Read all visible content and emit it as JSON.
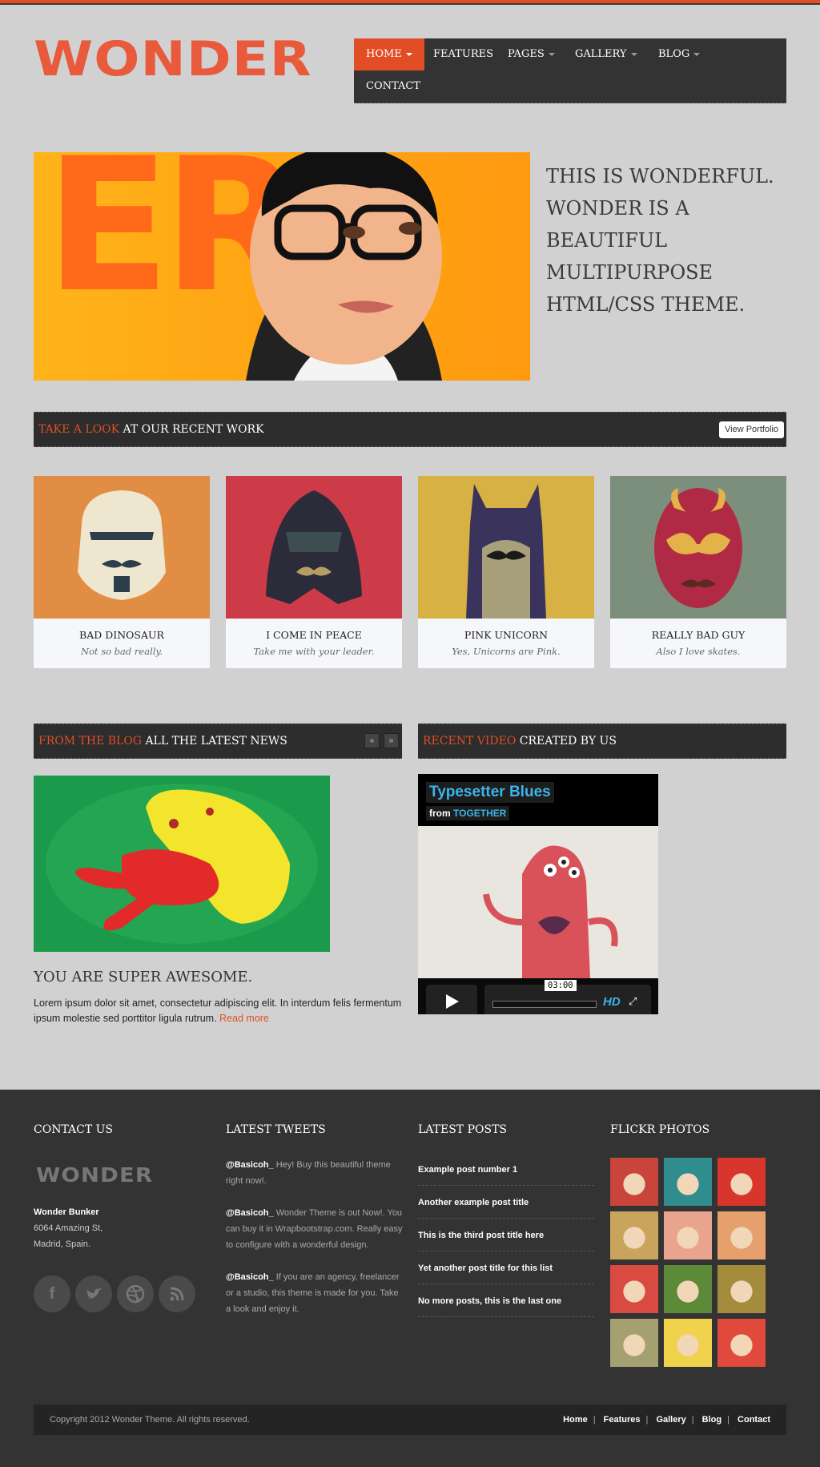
{
  "site": {
    "logo": "WONDER",
    "accent_color": "#e14e26"
  },
  "nav": {
    "items": [
      {
        "label": "HOME",
        "dropdown": true,
        "active": true
      },
      {
        "label": "FEATURES",
        "dropdown": false,
        "active": false
      },
      {
        "label": "PAGES",
        "dropdown": true,
        "active": false
      },
      {
        "label": "GALLERY",
        "dropdown": true,
        "active": false
      },
      {
        "label": "BLOG",
        "dropdown": true,
        "active": false
      },
      {
        "label": "CONTACT",
        "dropdown": false,
        "active": false
      }
    ]
  },
  "hero": {
    "headline": "THIS IS WONDERFUL. WONDER IS A BEAUTIFUL MULTIPURPOSE HTML/CSS THEME.",
    "image_letters": "ER"
  },
  "recent_work": {
    "title_accent": "TAKE A LOOK",
    "title_rest": "AT OUR RECENT WORK",
    "button": "View Portfolio",
    "items": [
      {
        "title": "BAD DINOSAUR",
        "subtitle": "Not so bad really.",
        "bg": "#e18e44"
      },
      {
        "title": "I COME IN PEACE",
        "subtitle": "Take me with your leader.",
        "bg": "#cd3a48"
      },
      {
        "title": "PINK UNICORN",
        "subtitle": "Yes, Unicorns are Pink.",
        "bg": "#d7b143"
      },
      {
        "title": "REALLY BAD GUY",
        "subtitle": "Also I love skates.",
        "bg": "#7c8e7c"
      }
    ]
  },
  "blog": {
    "title_accent": "FROM THE BLOG",
    "title_rest": "ALL THE LATEST NEWS",
    "prev": "«",
    "next": "»",
    "post_title": "YOU ARE SUPER AWESOME.",
    "excerpt": "Lorem ipsum dolor sit amet, consectetur adipiscing elit. In interdum felis fermentum ipsum molestie sed porttitor ligula rutrum.",
    "read_more": "Read more"
  },
  "video": {
    "title_accent": "RECENT VIDEO",
    "title_rest": "CREATED BY US",
    "video_title": "Typesetter Blues",
    "from_label": "from",
    "from_name": "TOGETHER",
    "time": "03:00",
    "hd": "HD"
  },
  "footer": {
    "contact": {
      "heading": "CONTACT US",
      "logo": "WONDER",
      "name": "Wonder Bunker",
      "address1": "6064 Amazing St,",
      "address2": "Madrid, Spain.",
      "social": [
        "facebook-icon",
        "twitter-icon",
        "dribbble-icon",
        "rss-icon"
      ]
    },
    "tweets": {
      "heading": "LATEST TWEETS",
      "items": [
        {
          "user": "@Basicoh_",
          "text": " Hey! Buy this beautiful theme right now!."
        },
        {
          "user": "@Basicoh_",
          "text": " Wonder Theme is out Now!. You can buy it in Wrapbootstrap.com. Really easy to configure with a wonderful design."
        },
        {
          "user": "@Basicoh_",
          "text": " If you are an agency, freelancer or a studio, this theme is made for you. Take a look and enjoy it."
        }
      ]
    },
    "posts": {
      "heading": "LATEST POSTS",
      "items": [
        "Example post number 1",
        "Another example post title",
        "This is the third post title here",
        "Yet another post title for this list",
        "No more posts, this is the last one"
      ]
    },
    "flickr": {
      "heading": "FLICKR PHOTOS",
      "colors": [
        "#c9443a",
        "#2f8d8e",
        "#d8362c",
        "#c9a45c",
        "#e8a48c",
        "#e6a06c",
        "#d94a40",
        "#5c8a38",
        "#a48c3c",
        "#a4a070",
        "#f0d24c",
        "#e04a3c"
      ]
    },
    "copyright": "Copyright 2012 Wonder Theme. All rights reserved.",
    "links": [
      "Home",
      "Features",
      "Gallery",
      "Blog",
      "Contact"
    ]
  }
}
